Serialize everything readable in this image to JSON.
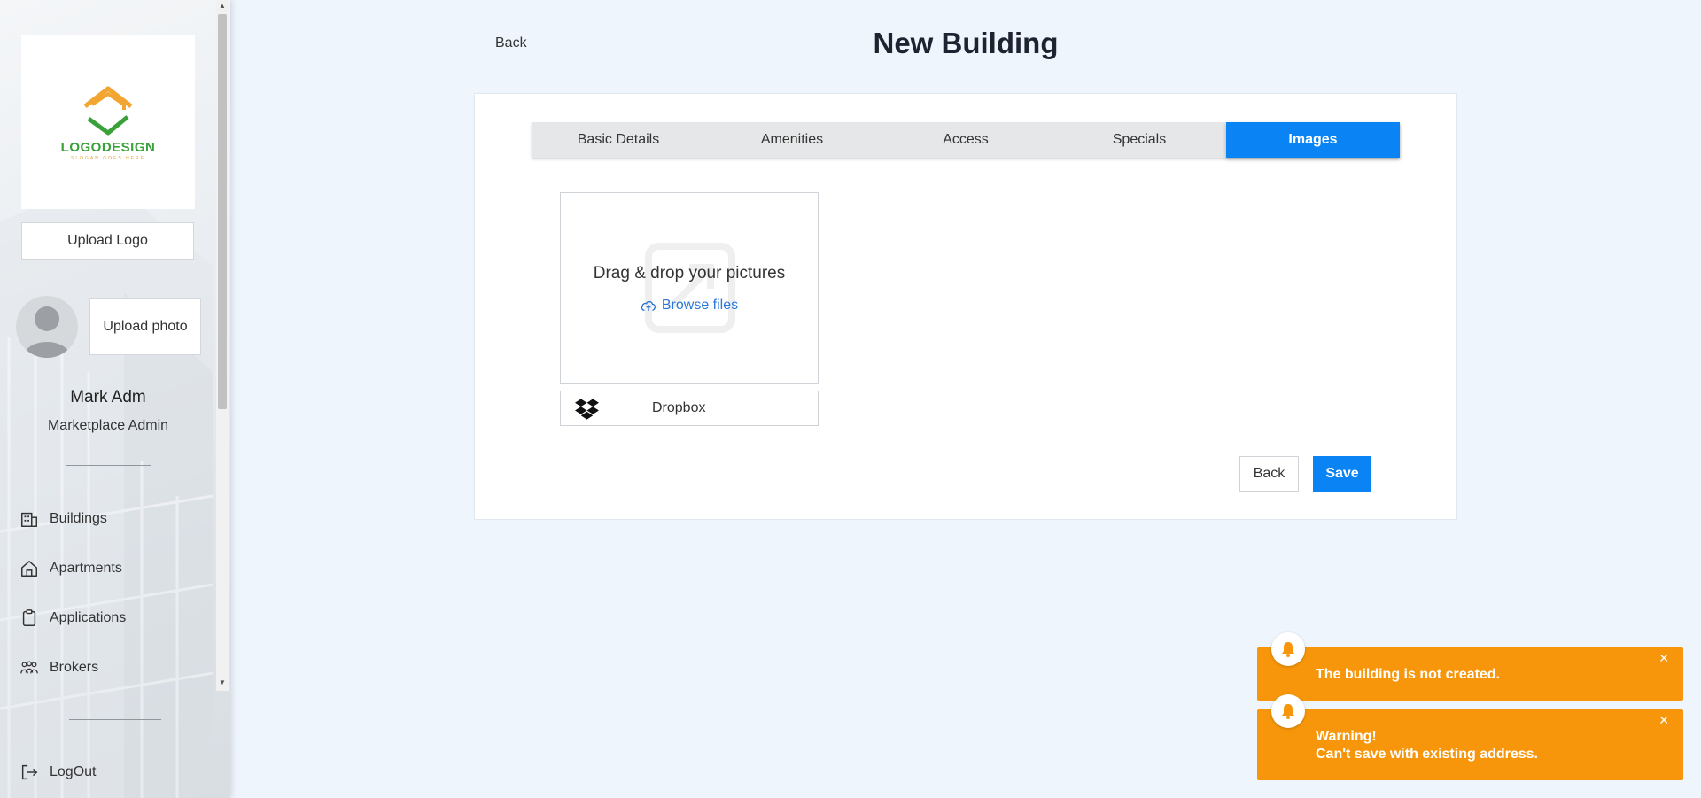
{
  "sidebar": {
    "logo": {
      "text": "LOGODESIGN",
      "slogan": "SLOGAN GOES HERE"
    },
    "upload_logo_label": "Upload Logo",
    "upload_photo_label": "Upload photo",
    "user": {
      "name": "Mark Adm",
      "role": "Marketplace Admin"
    },
    "nav": [
      {
        "label": "Buildings",
        "icon": "building-icon"
      },
      {
        "label": "Apartments",
        "icon": "home-icon"
      },
      {
        "label": "Applications",
        "icon": "clipboard-icon"
      },
      {
        "label": "Brokers",
        "icon": "people-icon"
      }
    ],
    "logout_label": "LogOut"
  },
  "header": {
    "back_label": "Back",
    "title": "New Building"
  },
  "tabs": [
    {
      "label": "Basic Details",
      "active": false
    },
    {
      "label": "Amenities",
      "active": false
    },
    {
      "label": "Access",
      "active": false
    },
    {
      "label": "Specials",
      "active": false
    },
    {
      "label": "Images",
      "active": true
    }
  ],
  "uploader": {
    "title": "Drag & drop your pictures",
    "browse_label": "Browse files",
    "dropbox_label": "Dropbox"
  },
  "actions": {
    "back_label": "Back",
    "save_label": "Save"
  },
  "toasts": [
    {
      "message": "The building is not created."
    },
    {
      "title": "Warning!",
      "message": "Can't save with existing address."
    }
  ],
  "colors": {
    "accent": "#0a84f5",
    "warning": "#f7960a",
    "link": "#2b78d6"
  }
}
